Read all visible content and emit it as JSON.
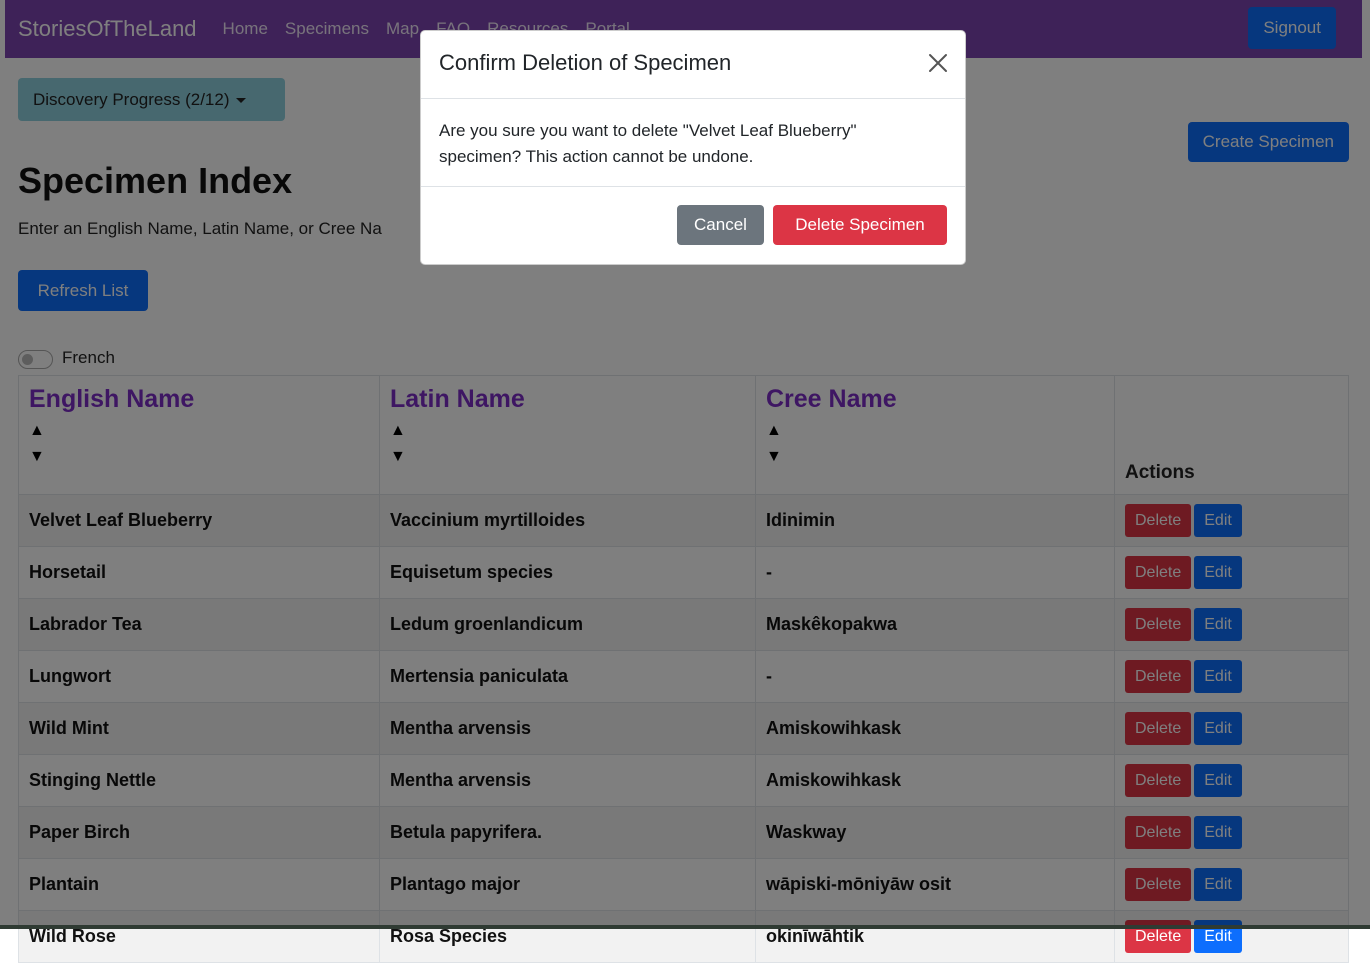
{
  "navbar": {
    "brand": "StoriesOfTheLand",
    "links": [
      "Home",
      "Specimens",
      "Map",
      "FAQ",
      "Resources",
      "Portal"
    ],
    "signout_label": "Signout"
  },
  "progress": {
    "label": "Discovery Progress (2/12)"
  },
  "create_label": "Create Specimen",
  "page": {
    "title": "Specimen Index",
    "hint": "Enter an English Name, Latin Name, or Cree Na",
    "refresh_label": "Refresh List",
    "toggle_label": "French"
  },
  "table": {
    "headers": {
      "english": "English Name",
      "latin": "Latin Name",
      "cree": "Cree Name",
      "actions": "Actions",
      "sort_up": "▲",
      "sort_down": "▼"
    },
    "delete_label": "Delete",
    "edit_label": "Edit",
    "rows": [
      {
        "english": "Velvet Leaf Blueberry",
        "latin": "Vaccinium myrtilloides",
        "cree": "Idinimin"
      },
      {
        "english": "Horsetail",
        "latin": "Equisetum species",
        "cree": "-"
      },
      {
        "english": "Labrador Tea",
        "latin": "Ledum groenlandicum",
        "cree": "Maskêkopakwa"
      },
      {
        "english": "Lungwort",
        "latin": "Mertensia paniculata",
        "cree": "-"
      },
      {
        "english": "Wild Mint",
        "latin": "Mentha arvensis",
        "cree": "Amiskowihkask"
      },
      {
        "english": "Stinging Nettle",
        "latin": "Mentha arvensis",
        "cree": "Amiskowihkask"
      },
      {
        "english": "Paper Birch",
        "latin": "Betula papyrifera.",
        "cree": "Waskway"
      },
      {
        "english": "Plantain",
        "latin": "Plantago major",
        "cree": "wāpiski-mōniyāw osit"
      },
      {
        "english": "Wild Rose",
        "latin": "Rosa Species",
        "cree": "okinīwāhtik"
      }
    ]
  },
  "modal": {
    "title": "Confirm Deletion of Specimen",
    "body": "Are you sure you want to delete \"Velvet Leaf Blueberry\" specimen? This action cannot be undone.",
    "cancel_label": "Cancel",
    "confirm_label": "Delete Specimen",
    "close_icon": "close-icon"
  },
  "colors": {
    "navbar": "#7d45b0",
    "primary": "#0d6efd",
    "danger": "#dc3545",
    "secondary": "#6c757d",
    "info": "#8fd0de",
    "header_text": "#7d2cc7"
  }
}
